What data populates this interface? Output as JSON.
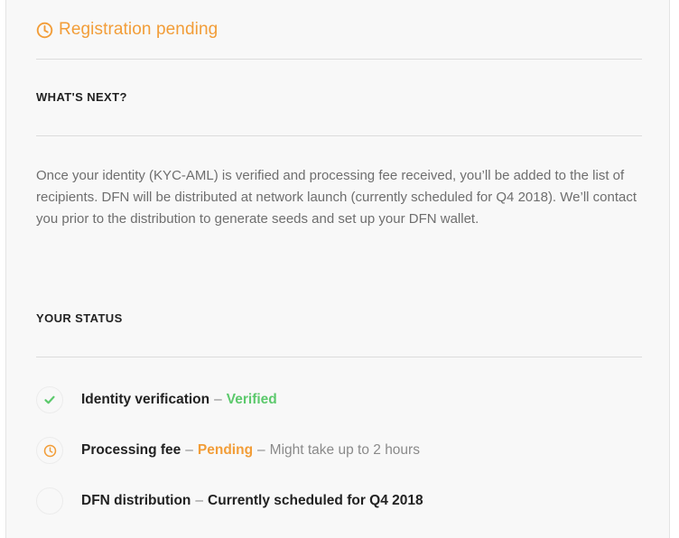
{
  "header": {
    "title": "Registration pending",
    "icon": "clock-icon",
    "accent_color": "#f29d38"
  },
  "whats_next": {
    "title": "WHAT'S NEXT?",
    "description": "Once your identity (KYC-AML) is verified and processing fee received, you’ll be added to the list of recipients. DFN will be distributed at network launch (currently scheduled for Q4 2018). We’ll contact you prior to the distribution to generate seeds and set up your DFN wallet."
  },
  "your_status": {
    "title": "YOUR STATUS",
    "items": [
      {
        "icon": "check-icon",
        "label": "Identity verification",
        "separator": "–",
        "status": "Verified",
        "status_color": "#5cc96c"
      },
      {
        "icon": "clock-icon",
        "label": "Processing fee",
        "separator": "–",
        "status": "Pending",
        "status_color": "#f29d38",
        "separator2": "–",
        "note": "Might take up to 2 hours"
      },
      {
        "icon": "empty-circle-icon",
        "label": "DFN distribution",
        "separator": "–",
        "value": "Currently scheduled for Q4 2018"
      }
    ]
  }
}
